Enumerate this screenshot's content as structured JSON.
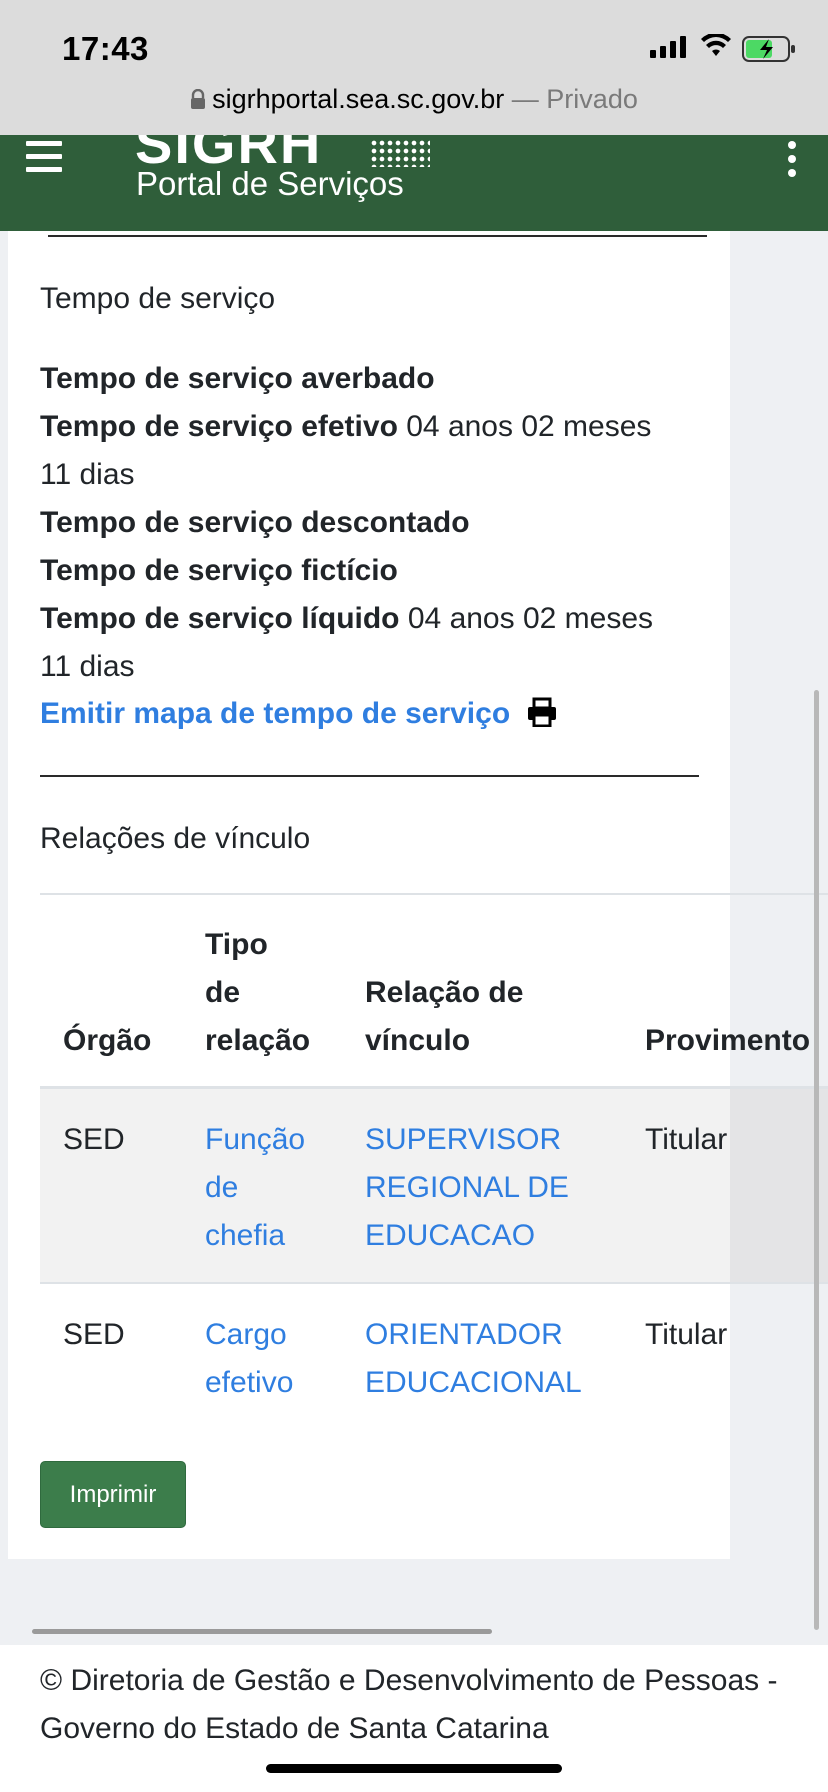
{
  "status_bar": {
    "time": "17:43",
    "url": "sigrhportal.sea.sc.gov.br",
    "url_suffix": "— Privado",
    "icons": [
      "signal-icon",
      "wifi-icon",
      "battery-charging-icon"
    ]
  },
  "header": {
    "logo_text": "SIGRH",
    "subtitle": "Portal de Serviços",
    "bg_color": "#2f5e3a"
  },
  "tempo": {
    "section_title": "Tempo de serviço",
    "averbado_label": "Tempo de serviço averbado",
    "efetivo_label": "Tempo de serviço efetivo",
    "efetivo_value_1": "04 anos 02 meses",
    "efetivo_value_2": "11 dias",
    "descontado_label": "Tempo de serviço descontado",
    "ficticio_label": "Tempo de serviço fictício",
    "liquido_label": "Tempo de serviço líquido",
    "liquido_value_1": "04 anos 02 meses",
    "liquido_value_2": "11 dias",
    "emit_link": "Emitir mapa de tempo de serviço"
  },
  "vinculo": {
    "section_title": "Relações de vínculo",
    "headers": {
      "orgao": "Órgão",
      "tipo_1": "Tipo",
      "tipo_2": "de",
      "tipo_3": "relação",
      "relacao_1": "Relação de",
      "relacao_2": "vínculo",
      "provimento": "Provimento"
    },
    "rows": [
      {
        "orgao": "SED",
        "tipo_1": "Função",
        "tipo_2": "de",
        "tipo_3": "chefia",
        "relacao_1": "SUPERVISOR",
        "relacao_2": "REGIONAL DE",
        "relacao_3": "EDUCACAO",
        "provimento": "Titular"
      },
      {
        "orgao": "SED",
        "tipo_1": "Cargo",
        "tipo_2": "efetivo",
        "relacao_1": "ORIENTADOR",
        "relacao_2": "EDUCACIONAL",
        "provimento": "Titular"
      }
    ],
    "print_button": "Imprimir"
  },
  "footer": {
    "text": "© Diretoria de Gestão e Desenvolvimento de Pessoas - Governo do Estado de Santa Catarina"
  }
}
